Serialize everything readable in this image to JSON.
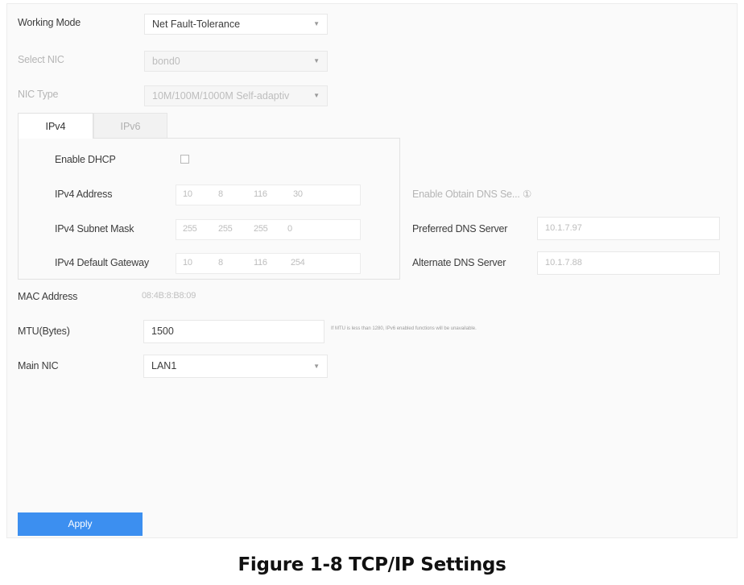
{
  "form": {
    "working_mode": {
      "label": "Working Mode",
      "value": "Net Fault-Tolerance"
    },
    "select_nic": {
      "label": "Select NIC",
      "value": "bond0"
    },
    "nic_type": {
      "label": "NIC Type",
      "value": "10M/100M/1000M Self-adaptiv"
    },
    "mac_address": {
      "label": "MAC Address",
      "value": "08:4B:8:B8:09"
    },
    "mtu": {
      "label": "MTU(Bytes)",
      "value": "1500",
      "note": "If MTU is less than 1280, IPv6 enabled functions will be unavailable."
    },
    "main_nic": {
      "label": "Main NIC",
      "value": "LAN1"
    }
  },
  "tabs": {
    "ipv4": "IPv4",
    "ipv6": "IPv6"
  },
  "ipv4": {
    "enable_dhcp_label": "Enable DHCP",
    "address": {
      "label": "IPv4 Address",
      "segments": [
        "10",
        "8",
        "116",
        "30"
      ]
    },
    "subnet_mask": {
      "label": "IPv4 Subnet Mask",
      "segments": [
        "255",
        "255",
        "255",
        "0"
      ]
    },
    "default_gateway": {
      "label": "IPv4 Default Gateway",
      "segments": [
        "10",
        "8",
        "116",
        "254"
      ]
    }
  },
  "dns": {
    "enable_obtain_label": "Enable Obtain DNS Se... ①",
    "preferred": {
      "label": "Preferred DNS Server",
      "value": "10.1.7.97"
    },
    "alternate": {
      "label": "Alternate DNS Server",
      "value": "10.1.7.88"
    }
  },
  "apply_label": "Apply",
  "caption": "Figure 1-8 TCP/IP Settings"
}
